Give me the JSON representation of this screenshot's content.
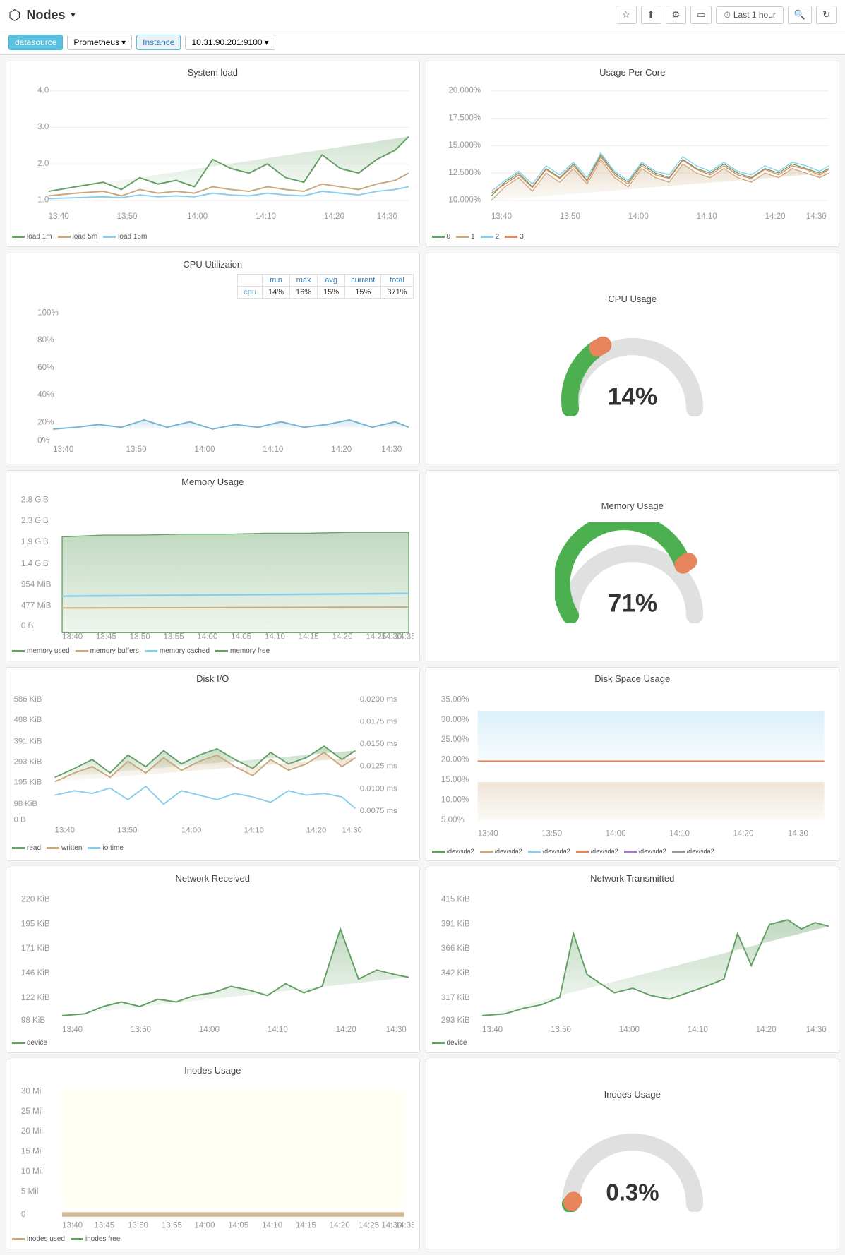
{
  "header": {
    "title": "Nodes",
    "time_range": "Last 1 hour",
    "icons": [
      "star",
      "share",
      "settings",
      "monitor",
      "search",
      "refresh"
    ]
  },
  "toolbar": {
    "datasource_label": "datasource",
    "prometheus_label": "Prometheus",
    "instance_label": "Instance",
    "instance_value": "10.31.90.201:9100"
  },
  "panels": {
    "system_load": {
      "title": "System load",
      "legend": [
        {
          "label": "load 1m",
          "color": "#629f62"
        },
        {
          "label": "load 5m",
          "color": "#c8a87a"
        },
        {
          "label": "load 15m",
          "color": "#87ceeb"
        }
      ],
      "x_ticks": [
        "13:40",
        "13:50",
        "14:00",
        "14:10",
        "14:20",
        "14:30"
      ],
      "y_ticks": [
        "4.0",
        "3.0",
        "2.0",
        "1.0"
      ]
    },
    "usage_per_core": {
      "title": "Usage Per Core",
      "legend": [
        {
          "label": "0",
          "color": "#629f62"
        },
        {
          "label": "1",
          "color": "#c8a87a"
        },
        {
          "label": "2",
          "color": "#87ceeb"
        },
        {
          "label": "3",
          "color": "#e8845c"
        }
      ],
      "x_ticks": [
        "13:40",
        "13:50",
        "14:00",
        "14:10",
        "14:20",
        "14:30"
      ],
      "y_ticks": [
        "20.000%",
        "17.500%",
        "15.000%",
        "12.500%",
        "10.000%"
      ]
    },
    "cpu_utilization": {
      "title": "CPU Utilizaion",
      "stats_headers": [
        "min",
        "max",
        "avg",
        "current",
        "total"
      ],
      "stats_row": {
        "label": "cpu",
        "values": [
          "14%",
          "16%",
          "15%",
          "15%",
          "371%"
        ]
      },
      "x_ticks": [
        "13:40",
        "13:50",
        "14:00",
        "14:10",
        "14:20",
        "14:30"
      ],
      "y_ticks": [
        "100%",
        "80%",
        "60%",
        "40%",
        "20%",
        "0%"
      ]
    },
    "cpu_usage_gauge": {
      "title": "CPU Usage",
      "value": "14%",
      "percent": 14
    },
    "memory_usage": {
      "title": "Memory Usage",
      "legend": [
        {
          "label": "memory used",
          "color": "#629f62"
        },
        {
          "label": "memory buffers",
          "color": "#c8a87a"
        },
        {
          "label": "memory cached",
          "color": "#87ceeb"
        },
        {
          "label": "memory free",
          "color": "#629f62"
        }
      ],
      "x_ticks": [
        "13:40",
        "13:45",
        "13:50",
        "13:55",
        "14:00",
        "14:05",
        "14:10",
        "14:15",
        "14:20",
        "14:25",
        "14:30",
        "14:35"
      ],
      "y_ticks": [
        "2.8 GiB",
        "2.3 GiB",
        "1.9 GiB",
        "1.4 GiB",
        "954 MiB",
        "477 MiB",
        "0 B"
      ]
    },
    "memory_usage_gauge": {
      "title": "Memory Usage",
      "value": "71%",
      "percent": 71
    },
    "disk_io": {
      "title": "Disk I/O",
      "legend": [
        {
          "label": "read",
          "color": "#629f62"
        },
        {
          "label": "written",
          "color": "#c8a87a"
        },
        {
          "label": "io time",
          "color": "#87ceeb"
        }
      ],
      "x_ticks": [
        "13:40",
        "13:50",
        "14:00",
        "14:10",
        "14:20",
        "14:30"
      ],
      "y_left": [
        "586 KiB",
        "488 KiB",
        "391 KiB",
        "293 KiB",
        "195 KiB",
        "98 KiB",
        "0 B"
      ],
      "y_right": [
        "0.0200 ms",
        "0.0175 ms",
        "0.0150 ms",
        "0.0125 ms",
        "0.0100 ms",
        "0.0075 ms"
      ]
    },
    "disk_space": {
      "title": "Disk Space Usage",
      "legend": [
        {
          "label": "/dev/sda2",
          "color": "#629f62"
        },
        {
          "label": "/dev/sda2",
          "color": "#c8a87a"
        },
        {
          "label": "/dev/sda2",
          "color": "#87ceeb"
        },
        {
          "label": "/dev/sda2",
          "color": "#e8845c"
        },
        {
          "label": "/dev/sda2",
          "color": "#aa7acc"
        },
        {
          "label": "/dev/sda2",
          "color": "#999"
        }
      ],
      "x_ticks": [
        "13:40",
        "13:50",
        "14:00",
        "14:10",
        "14:20",
        "14:30"
      ],
      "y_ticks": [
        "35.00%",
        "30.00%",
        "25.00%",
        "20.00%",
        "15.00%",
        "10.00%",
        "5.00%"
      ]
    },
    "network_received": {
      "title": "Network Received",
      "legend": [
        {
          "label": "device",
          "color": "#629f62"
        }
      ],
      "x_ticks": [
        "13:40",
        "13:50",
        "14:00",
        "14:10",
        "14:20",
        "14:30"
      ],
      "y_ticks": [
        "220 KiB",
        "195 KiB",
        "171 KiB",
        "146 KiB",
        "122 KiB",
        "98 KiB"
      ]
    },
    "network_transmitted": {
      "title": "Network Transmitted",
      "legend": [
        {
          "label": "device",
          "color": "#629f62"
        }
      ],
      "x_ticks": [
        "13:40",
        "13:50",
        "14:00",
        "14:10",
        "14:20",
        "14:30"
      ],
      "y_ticks": [
        "415 KiB",
        "391 KiB",
        "366 KiB",
        "342 KiB",
        "317 KiB",
        "293 KiB"
      ]
    },
    "inodes_usage_chart": {
      "title": "Inodes Usage",
      "legend": [
        {
          "label": "inodes used",
          "color": "#c8a87a"
        },
        {
          "label": "inodes free",
          "color": "#629f62"
        }
      ],
      "x_ticks": [
        "13:40",
        "13:45",
        "13:50",
        "13:55",
        "14:00",
        "14:05",
        "14:10",
        "14:15",
        "14:20",
        "14:25",
        "14:30",
        "14:35"
      ],
      "y_ticks": [
        "30 Mil",
        "25 Mil",
        "20 Mil",
        "15 Mil",
        "10 Mil",
        "5 Mil",
        "0"
      ]
    },
    "inodes_usage_gauge": {
      "title": "Inodes Usage",
      "value": "0.3%",
      "percent": 0.3
    }
  }
}
